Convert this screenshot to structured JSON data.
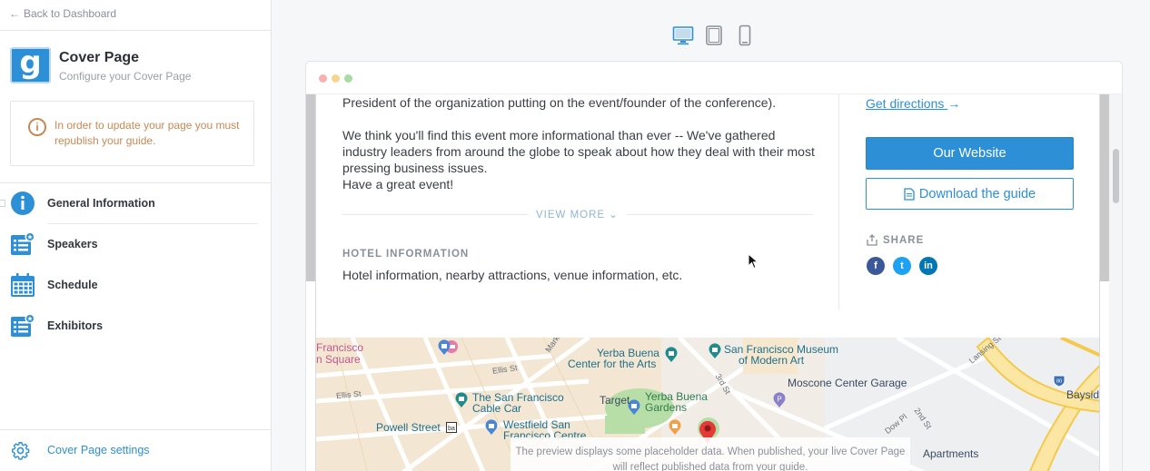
{
  "sidebar": {
    "back_label": "Back to Dashboard",
    "logo_letter": "g",
    "title": "Cover Page",
    "subtitle": "Configure your Cover Page",
    "warning": "In order to update your page you must republish your guide.",
    "items": [
      {
        "label": "General Information",
        "icon": "info-icon"
      },
      {
        "label": "Speakers",
        "icon": "list-badge-icon"
      },
      {
        "label": "Schedule",
        "icon": "calendar-icon"
      },
      {
        "label": "Exhibitors",
        "icon": "list-badge-icon"
      }
    ],
    "settings_label": "Cover Page settings"
  },
  "devices": [
    "desktop-icon",
    "tablet-icon",
    "mobile-icon"
  ],
  "preview": {
    "description_1": "President of the organization putting on the event/founder of the conference).",
    "description_2": "We think you'll find this event more informational than ever -- We've gathered industry leaders from around the globe to speak about how they deal with their most pressing business issues.",
    "description_3": "Have a great event!",
    "view_more": "VIEW MORE",
    "hotel_heading": "HOTEL INFORMATION",
    "hotel_text": "Hotel information, nearby attractions, venue information, etc.",
    "directions": "Get directions",
    "website_button": "Our Website",
    "download_button": "Download the guide",
    "share_label": "SHARE",
    "social": [
      {
        "letter": "f",
        "color": "#3b5998"
      },
      {
        "letter": "t",
        "color": "#1da1f2"
      },
      {
        "letter": "in",
        "color": "#0077b5"
      }
    ],
    "notice": "The preview displays some placeholder data. When published, your live Cover Page will reflect published data from your guide."
  },
  "map": {
    "labels": {
      "francisco_square": "Francisco",
      "union_square": "n Square",
      "yerba_center": "Yerba Buena",
      "center_arts": "Center for the Arts",
      "sfmoma_1": "San Francisco Museum",
      "sfmoma_2": "of Modern Art",
      "moscone": "Moscone Center Garage",
      "cable_car_1": "The San Francisco",
      "cable_car_2": "Cable Car",
      "target": "Target",
      "yerba_gardens_1": "Yerba Buena",
      "yerba_gardens_2": "Gardens",
      "powell": "Powell Street",
      "westfield_1": "Westfield San",
      "westfield_2": "Francisco Centre",
      "bayside": "Bayside",
      "apartments": "Apartments",
      "ellis_st": "Ellis St",
      "ellis_st2": "Ellis St",
      "third_st": "3rd St",
      "second_st": "2nd St",
      "dow_pl": "Dow Pl",
      "lansing": "Lansing St",
      "market": "Mark",
      "hwy": "80"
    }
  },
  "colors": {
    "accent": "#2d8fd5",
    "warning": "#c58a55"
  }
}
